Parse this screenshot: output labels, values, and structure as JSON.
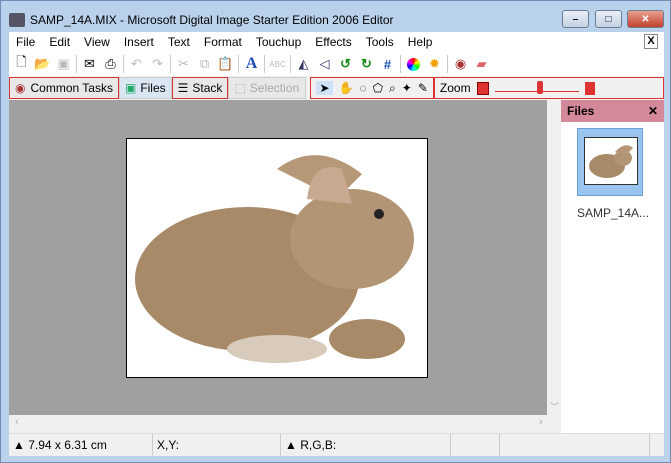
{
  "window": {
    "title": "SAMP_14A.MIX - Microsoft Digital Image Starter Edition 2006 Editor",
    "minimize": "–",
    "maximize": "□",
    "close": "✕"
  },
  "menu": [
    "File",
    "Edit",
    "View",
    "Insert",
    "Text",
    "Format",
    "Touchup",
    "Effects",
    "Tools",
    "Help"
  ],
  "menu_close": "X",
  "toolbar": [
    "new-icon",
    "open-icon",
    "save-icon",
    "email-icon",
    "print-icon",
    "undo-icon",
    "redo-icon",
    "cut-icon",
    "copy-icon",
    "paste-icon",
    "text-icon",
    "spellcheck-icon",
    "flip-icon",
    "rotate-icon",
    "rotate-left-icon",
    "rotate-right-icon",
    "crop-icon",
    "color-icon",
    "brightness-icon",
    "red-eye-icon",
    "eraser-icon"
  ],
  "tasks": {
    "common": "Common Tasks",
    "files": "Files",
    "stack": "Stack",
    "selection": "Selection",
    "zoom": "Zoom"
  },
  "zoom_level": 0.55,
  "panel": {
    "title": "Files",
    "close": "✕",
    "file": "SAMP_14A..."
  },
  "status": {
    "size": "▲ 7.94 x 6.31 cm",
    "xy": "X,Y:",
    "rgb": "▲ R,G,B:"
  }
}
